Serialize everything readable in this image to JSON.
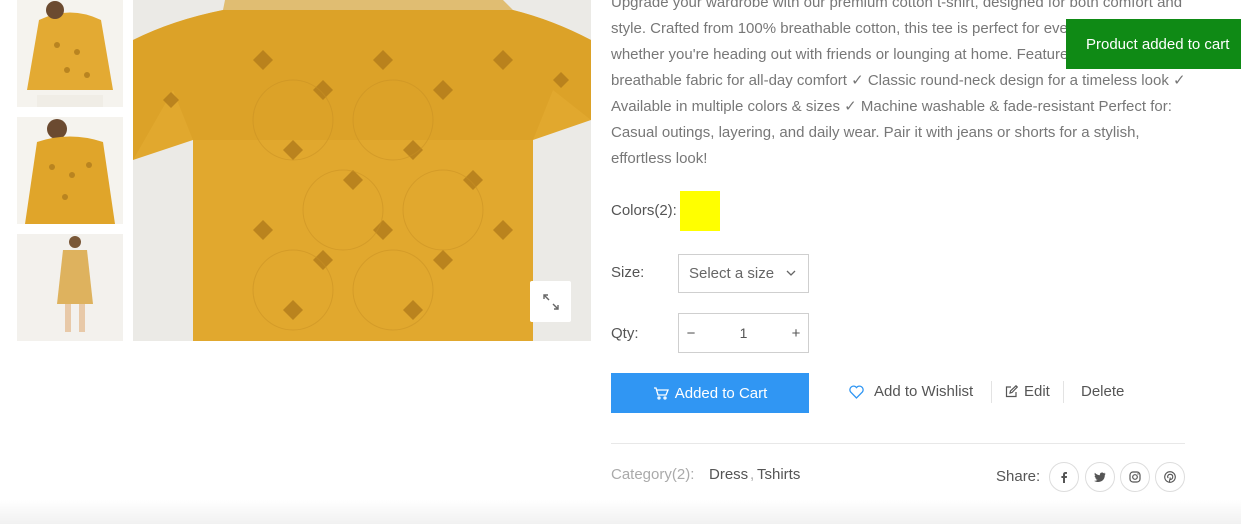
{
  "gallery": {
    "thumbnails": [
      {
        "icon": "dress-thumbnail-image-1"
      },
      {
        "icon": "dress-thumbnail-image-2"
      },
      {
        "icon": "dress-thumbnail-image-3"
      }
    ],
    "main_image": {
      "icon": "yellow-dress-main-image"
    },
    "zoom_icon": "expand-icon"
  },
  "product": {
    "description": "Upgrade your wardrobe with our premium cotton t-shirt, designed for both comfort and style. Crafted from 100% breathable cotton, this tee is perfect for everyday wear, whether you're heading out with friends or lounging at home. Features: ✓ Soft & breathable fabric for all-day comfort ✓ Classic round-neck design for a timeless look ✓ Available in multiple colors & sizes ✓ Machine washable & fade-resistant Perfect for: Casual outings, layering, and daily wear. Pair it with jeans or shorts for a stylish, effortless look!",
    "colors_label": "Colors(2):",
    "color_swatch": "#ffff00",
    "size_label": "Size:",
    "size_placeholder": "Select a size",
    "qty_label": "Qty:",
    "qty_minus": "−",
    "qty_value": "1",
    "qty_plus": "+"
  },
  "actions": {
    "cart_label": "Added to Cart",
    "wishlist_label": "Add to Wishlist",
    "edit_label": "Edit",
    "delete_label": "Delete"
  },
  "meta": {
    "category_label": "Category(2):",
    "categories": [
      "Dress",
      "Tshirts"
    ],
    "comma": ",",
    "share_label": "Share:",
    "socials": [
      "facebook-icon",
      "twitter-icon",
      "instagram-icon",
      "pinterest-icon"
    ]
  },
  "toast": {
    "message": "Product added to cart"
  },
  "colors": {
    "accent_blue": "#3096f3",
    "toast_green": "#0f8a15",
    "dress_yellow": "#e0a52a"
  }
}
